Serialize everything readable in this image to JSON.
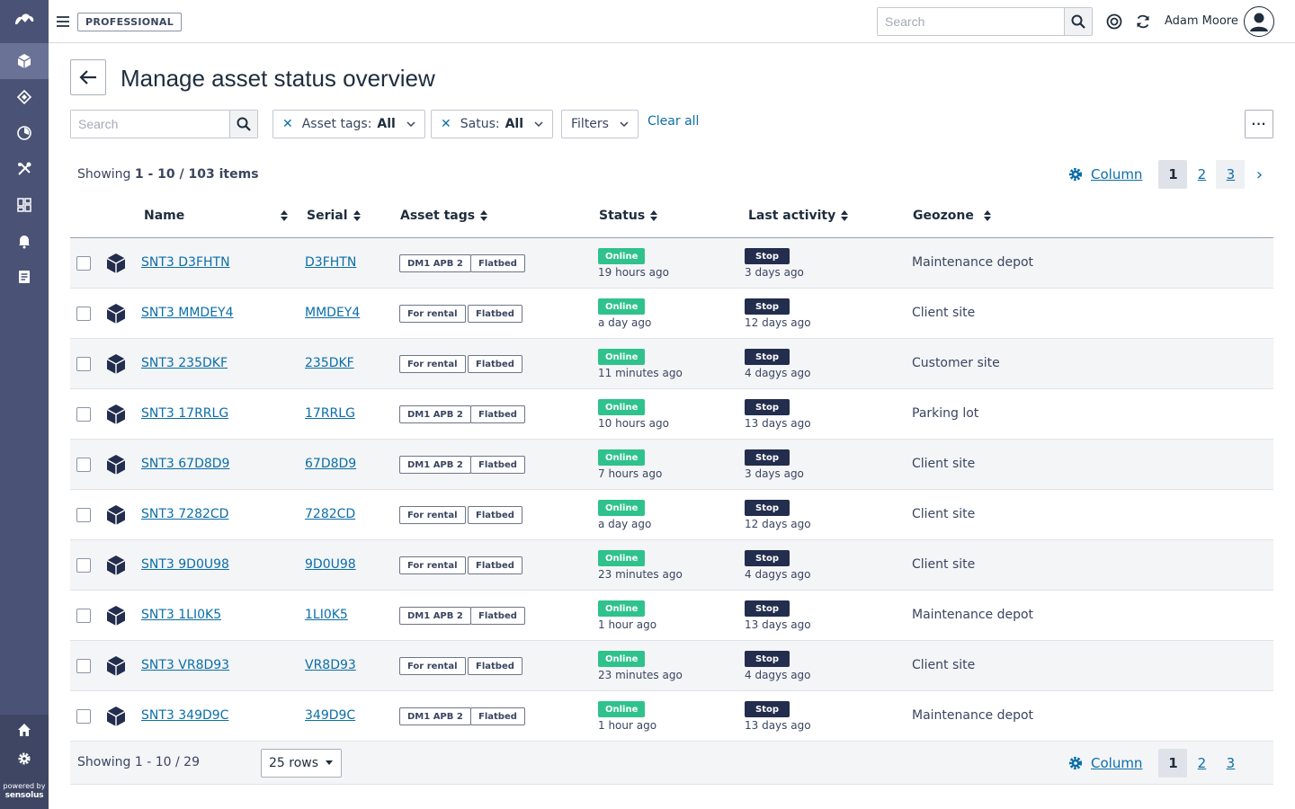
{
  "app": {
    "plan_badge": "PROFESSIONAL",
    "top_search_placeholder": "Search",
    "user_name": "Adam Moore",
    "powered_by": "powered by",
    "brand": "sensolus"
  },
  "page": {
    "title": "Manage asset status overview"
  },
  "filters": {
    "search_placeholder": "Search",
    "asset_tags_label": "Asset tags:",
    "asset_tags_value": "All",
    "status_label": "Satus:",
    "status_value": "All",
    "filters_label": "Filters",
    "clear_all": "Clear all",
    "more": "···"
  },
  "summary": {
    "showing_prefix": "Showing ",
    "showing_range": "1 - 10 / 103 items"
  },
  "pagination": {
    "column_label": "Column",
    "pages": [
      "1",
      "2",
      "3"
    ],
    "next": "›"
  },
  "table": {
    "columns": [
      "Name",
      "Serial",
      "Asset tags",
      "Status",
      "Last activity",
      "Geozone"
    ],
    "rows": [
      {
        "name": "SNT3 D3FHTN",
        "serial": "D3FHTN",
        "tag1": "DM1 APB 2",
        "tag2": "Flatbed",
        "status": "Online",
        "status_time": "19 hours ago",
        "activity": "Stop",
        "activity_time": "3 days ago",
        "geozone": "Maintenance depot"
      },
      {
        "name": "SNT3 MMDEY4",
        "serial": "MMDEY4",
        "tag1": "For rental",
        "tag2": "Flatbed",
        "status": "Online",
        "status_time": "a day ago",
        "activity": "Stop",
        "activity_time": "12 days ago",
        "geozone": "Client site"
      },
      {
        "name": "SNT3 235DKF",
        "serial": "235DKF",
        "tag1": "For rental",
        "tag2": "Flatbed",
        "status": "Online",
        "status_time": "11 minutes ago",
        "activity": "Stop",
        "activity_time": "4 dagys ago",
        "geozone": "Customer site"
      },
      {
        "name": "SNT3 17RRLG",
        "serial": "17RRLG",
        "tag1": "DM1 APB 2",
        "tag2": "Flatbed",
        "status": "Online",
        "status_time": "10 hours ago",
        "activity": "Stop",
        "activity_time": "13 days ago",
        "geozone": "Parking lot"
      },
      {
        "name": "SNT3 67D8D9",
        "serial": "67D8D9",
        "tag1": "DM1 APB 2",
        "tag2": "Flatbed",
        "status": "Online",
        "status_time": "7 hours ago",
        "activity": "Stop",
        "activity_time": "3 days ago",
        "geozone": "Client site"
      },
      {
        "name": "SNT3 7282CD",
        "serial": "7282CD",
        "tag1": "For rental",
        "tag2": "Flatbed",
        "status": "Online",
        "status_time": "a day ago",
        "activity": "Stop",
        "activity_time": "12 days ago",
        "geozone": "Client site"
      },
      {
        "name": "SNT3 9D0U98",
        "serial": "9D0U98",
        "tag1": "For rental",
        "tag2": "Flatbed",
        "status": "Online",
        "status_time": "23 minutes ago",
        "activity": "Stop",
        "activity_time": "4 dagys ago",
        "geozone": "Client site"
      },
      {
        "name": "SNT3 1LI0K5",
        "serial": "1LI0K5",
        "tag1": "DM1 APB 2",
        "tag2": "Flatbed",
        "status": "Online",
        "status_time": "1 hour ago",
        "activity": "Stop",
        "activity_time": "13 days ago",
        "geozone": "Maintenance depot"
      },
      {
        "name": "SNT3 VR8D93",
        "serial": "VR8D93",
        "tag1": "For rental",
        "tag2": "Flatbed",
        "status": "Online",
        "status_time": "23 minutes ago",
        "activity": "Stop",
        "activity_time": "4 dagys ago",
        "geozone": "Client site"
      },
      {
        "name": "SNT3 349D9C",
        "serial": "349D9C",
        "tag1": "DM1 APB 2",
        "tag2": "Flatbed",
        "status": "Online",
        "status_time": "1 hour ago",
        "activity": "Stop",
        "activity_time": "13 days ago",
        "geozone": "Maintenance depot"
      }
    ]
  },
  "footer": {
    "showing": "Showing 1 - 10 / 29",
    "rows_per_page": "25 rows"
  },
  "colors": {
    "sidebar": "#4a5375",
    "link": "#0b6ea8",
    "online": "#2fc28c",
    "stop": "#232d4d"
  },
  "icons": {
    "sidebar": [
      "logo-icon",
      "asset-cube-icon",
      "tag-icon",
      "gauge-icon",
      "tools-icon",
      "dashboard-icon",
      "bell-icon",
      "report-icon",
      "home-icon",
      "gear-icon"
    ]
  }
}
